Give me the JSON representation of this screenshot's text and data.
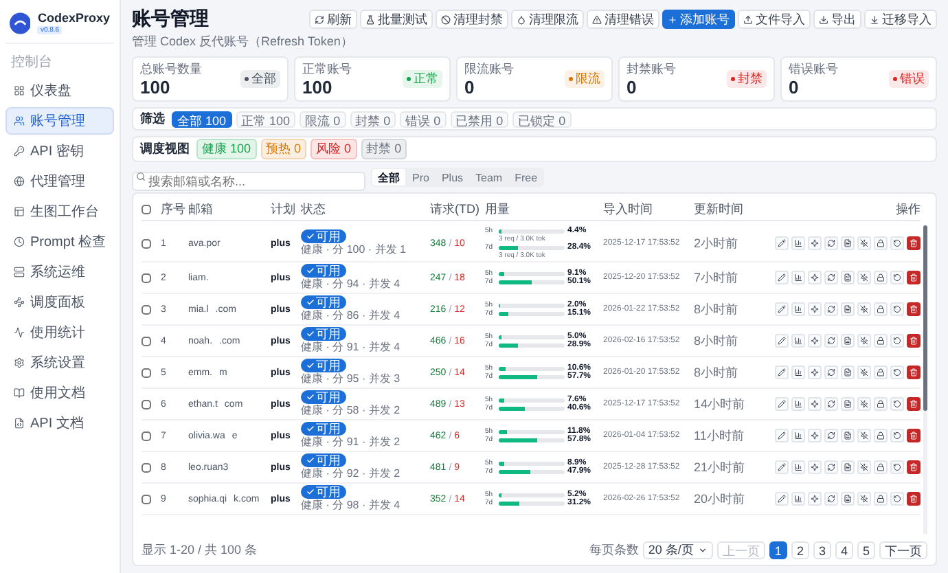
{
  "app": {
    "name": "CodexProxy",
    "version": "v0.8.6"
  },
  "sidebar": {
    "section": "控制台",
    "items": [
      {
        "label": "仪表盘",
        "selected": false
      },
      {
        "label": "账号管理",
        "selected": true
      },
      {
        "label": "API 密钥",
        "selected": false
      },
      {
        "label": "代理管理",
        "selected": false
      },
      {
        "label": "生图工作台",
        "selected": false
      },
      {
        "label": "Prompt 检查",
        "selected": false
      },
      {
        "label": "系统运维",
        "selected": false
      },
      {
        "label": "调度面板",
        "selected": false
      },
      {
        "label": "使用统计",
        "selected": false
      },
      {
        "label": "系统设置",
        "selected": false
      },
      {
        "label": "使用文档",
        "selected": false
      },
      {
        "label": "API 文档",
        "selected": false
      }
    ]
  },
  "page": {
    "title": "账号管理",
    "subtitle": "管理 Codex 反代账号（Refresh Token）"
  },
  "actions": [
    {
      "label": "刷新",
      "kind": "default"
    },
    {
      "label": "批量测试",
      "kind": "default"
    },
    {
      "label": "清理封禁",
      "kind": "default"
    },
    {
      "label": "清理限流",
      "kind": "default"
    },
    {
      "label": "清理错误",
      "kind": "default"
    },
    {
      "label": "添加账号",
      "kind": "primary"
    },
    {
      "label": "文件导入",
      "kind": "default"
    },
    {
      "label": "导出",
      "kind": "default"
    },
    {
      "label": "迁移导入",
      "kind": "default"
    }
  ],
  "stats": [
    {
      "label": "总账号数量",
      "value": "100",
      "badge": "全部",
      "color": "#4b5563"
    },
    {
      "label": "正常账号",
      "value": "100",
      "badge": "正常",
      "color": "#16a34a"
    },
    {
      "label": "限流账号",
      "value": "0",
      "badge": "限流",
      "color": "#d97706"
    },
    {
      "label": "封禁账号",
      "value": "0",
      "badge": "封禁",
      "color": "#dc2626"
    },
    {
      "label": "错误账号",
      "value": "0",
      "badge": "错误",
      "color": "#dc2626"
    }
  ],
  "filter": {
    "label": "筛选",
    "chips": [
      {
        "label": "全部 100",
        "selected": true
      },
      {
        "label": "正常 100",
        "selected": false
      },
      {
        "label": "限流 0",
        "selected": false
      },
      {
        "label": "封禁 0",
        "selected": false
      },
      {
        "label": "错误 0",
        "selected": false
      },
      {
        "label": "已禁用 0",
        "selected": false
      },
      {
        "label": "已锁定 0",
        "selected": false
      }
    ]
  },
  "schedule": {
    "label": "调度视图",
    "chips": [
      {
        "label": "健康 100",
        "color": "#16a34a"
      },
      {
        "label": "预热 0",
        "color": "#d97706"
      },
      {
        "label": "风险 0",
        "color": "#dc2626"
      },
      {
        "label": "封禁 0",
        "color": "#6b7280"
      }
    ]
  },
  "search": {
    "placeholder": "搜索邮箱或名称..."
  },
  "plan_tabs": [
    {
      "label": "全部",
      "selected": true
    },
    {
      "label": "Pro",
      "selected": false
    },
    {
      "label": "Plus",
      "selected": false
    },
    {
      "label": "Team",
      "selected": false
    },
    {
      "label": "Free",
      "selected": false
    }
  ],
  "table": {
    "select_all": {
      "checked": false
    },
    "columns": [
      "序号",
      "邮箱",
      "计划",
      "状态",
      "请求(TD)",
      "用量",
      "导入时间",
      "更新时间",
      "操作"
    ],
    "rows": [
      {
        "checked": false,
        "index": "1",
        "email": "ava.por",
        "plan": "plus",
        "status": "可用",
        "health": "健康 · 分 100 · 并发 1",
        "requests": {
          "ok": "348",
          "separator": "/",
          "err": "10"
        },
        "usage": [
          {
            "window": "5h",
            "level": 0.044,
            "percent": "4.4%",
            "note": "3 req / 3.0K tok"
          },
          {
            "window": "7d",
            "level": 0.284,
            "percent": "28.4%",
            "note": "3 req / 3.0K tok"
          }
        ],
        "imported": "2025-12-17 17:53:52",
        "updated": "2小时前"
      },
      {
        "checked": false,
        "index": "2",
        "email": "liam.",
        "plan": "plus",
        "status": "可用",
        "health": "健康 · 分 94 · 并发 4",
        "requests": {
          "ok": "247",
          "separator": "/",
          "err": "18"
        },
        "usage": [
          {
            "window": "5h",
            "level": 0.091,
            "percent": "9.1%"
          },
          {
            "window": "7d",
            "level": 0.501,
            "percent": "50.1%"
          }
        ],
        "imported": "2025-12-20 17:53:52",
        "updated": "7小时前"
      },
      {
        "checked": false,
        "index": "3",
        "email": "mia.l",
        "email_tail": ".com",
        "plan": "plus",
        "status": "可用",
        "health": "健康 · 分 86 · 并发 4",
        "requests": {
          "ok": "216",
          "separator": "/",
          "err": "12"
        },
        "usage": [
          {
            "window": "5h",
            "level": 0.02,
            "percent": "2.0%"
          },
          {
            "window": "7d",
            "level": 0.151,
            "percent": "15.1%"
          }
        ],
        "imported": "2026-01-22 17:53:52",
        "updated": "8小时前"
      },
      {
        "checked": false,
        "index": "4",
        "email": "noah.",
        "email_tail": ".com",
        "plan": "plus",
        "status": "可用",
        "health": "健康 · 分 91 · 并发 4",
        "requests": {
          "ok": "466",
          "separator": "/",
          "err": "16"
        },
        "usage": [
          {
            "window": "5h",
            "level": 0.05,
            "percent": "5.0%"
          },
          {
            "window": "7d",
            "level": 0.289,
            "percent": "28.9%"
          }
        ],
        "imported": "2026-02-16 17:53:52",
        "updated": "8小时前"
      },
      {
        "checked": false,
        "index": "5",
        "email": "emm.",
        "email_tail": "m",
        "plan": "plus",
        "status": "可用",
        "health": "健康 · 分 95 · 并发 3",
        "requests": {
          "ok": "250",
          "separator": "/",
          "err": "14"
        },
        "usage": [
          {
            "window": "5h",
            "level": 0.106,
            "percent": "10.6%"
          },
          {
            "window": "7d",
            "level": 0.577,
            "percent": "57.7%"
          }
        ],
        "imported": "2026-01-20 17:53:52",
        "updated": "8小时前"
      },
      {
        "checked": false,
        "index": "6",
        "email": "ethan.t",
        "email_tail": "com",
        "plan": "plus",
        "status": "可用",
        "health": "健康 · 分 58 · 并发 2",
        "requests": {
          "ok": "489",
          "separator": "/",
          "err": "13"
        },
        "usage": [
          {
            "window": "5h",
            "level": 0.076,
            "percent": "7.6%"
          },
          {
            "window": "7d",
            "level": 0.406,
            "percent": "40.6%"
          }
        ],
        "imported": "2025-12-17 17:53:52",
        "updated": "14小时前"
      },
      {
        "checked": false,
        "index": "7",
        "email": "olivia.wa",
        "email_tail": "e",
        "plan": "plus",
        "status": "可用",
        "health": "健康 · 分 91 · 并发 2",
        "requests": {
          "ok": "462",
          "separator": "/",
          "err": "6"
        },
        "usage": [
          {
            "window": "5h",
            "level": 0.118,
            "percent": "11.8%"
          },
          {
            "window": "7d",
            "level": 0.578,
            "percent": "57.8%"
          }
        ],
        "imported": "2026-01-04 17:53:52",
        "updated": "11小时前"
      },
      {
        "checked": false,
        "index": "8",
        "email": "leo.ruan3",
        "plan": "plus",
        "status": "可用",
        "health": "健康 · 分 92 · 并发 2",
        "requests": {
          "ok": "481",
          "separator": "/",
          "err": "9"
        },
        "usage": [
          {
            "window": "5h",
            "level": 0.089,
            "percent": "8.9%"
          },
          {
            "window": "7d",
            "level": 0.479,
            "percent": "47.9%"
          }
        ],
        "imported": "2025-12-28 17:53:52",
        "updated": "21小时前"
      },
      {
        "checked": false,
        "index": "9",
        "email": "sophia.qi",
        "email_tail": "k.com",
        "plan": "plus",
        "status": "可用",
        "health": "健康 · 分 98 · 并发 4",
        "requests": {
          "ok": "352",
          "separator": "/",
          "err": "14"
        },
        "usage": [
          {
            "window": "5h",
            "level": 0.052,
            "percent": "5.2%"
          },
          {
            "window": "7d",
            "level": 0.312,
            "percent": "31.2%"
          }
        ],
        "imported": "2026-02-26 17:53:52",
        "updated": "20小时前"
      }
    ]
  },
  "footer": {
    "summary": "显示 1-20 / 共 100 条",
    "page_size_label": "每页条数",
    "page_size": "20 条/页",
    "prev": {
      "label": "上一页",
      "disabled": true
    },
    "pages": [
      {
        "label": "1",
        "selected": true
      },
      {
        "label": "2",
        "selected": false
      },
      {
        "label": "3",
        "selected": false
      },
      {
        "label": "4",
        "selected": false
      },
      {
        "label": "5",
        "selected": false
      }
    ],
    "next": {
      "label": "下一页",
      "disabled": false
    }
  }
}
